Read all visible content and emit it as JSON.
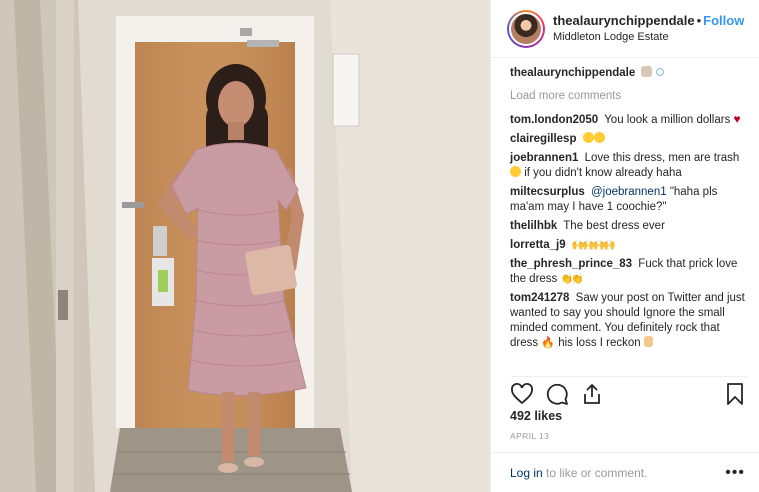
{
  "header": {
    "username": "thealaurynchippendale",
    "separator": "•",
    "follow_label": "Follow",
    "location": "Middleton Lodge Estate"
  },
  "caption": {
    "username": "thealaurynchippendale",
    "icons": [
      "people-emoji",
      "ring-emoji"
    ]
  },
  "load_more_label": "Load more comments",
  "comments": [
    {
      "user": "tom.london2050",
      "text": "You look a million dollars",
      "emoji": "red-heart"
    },
    {
      "user": "clairegillesp",
      "text": "",
      "emoji": "heart-eyes"
    },
    {
      "user": "joebrannen1",
      "text": "Love this dress, men are trash",
      "emoji": "slightly-smiling-face",
      "text2": "if you didn't know already haha"
    },
    {
      "user": "miltecsurplus",
      "mention": "@joebrannen1",
      "text": "\"haha pls ma'am may I have 1 coochie?\""
    },
    {
      "user": "thelilhbk",
      "text": "The best dress ever"
    },
    {
      "user": "lorretta_j9",
      "text": "",
      "emoji": "raised-hands"
    },
    {
      "user": "the_phresh_prince_83",
      "text": "Fuck that prick love the dress",
      "emoji": "clapping-hands"
    },
    {
      "user": "tom241278",
      "text": "Saw your post on Twitter and just wanted to say you should Ignore the small minded comment. You definitely rock that dress",
      "emoji": "fire",
      "text2": "his loss I reckon",
      "emoji2": "ok-hand"
    }
  ],
  "icons": {
    "like": "heart-icon",
    "comment": "comment-bubble-icon",
    "share": "share-icon",
    "save": "bookmark-icon"
  },
  "likes": "492 likes",
  "date": "APRIL 13",
  "footer": {
    "login_label": "Log in",
    "rest": " to like or comment.",
    "more_label": "•••"
  },
  "colors": {
    "link": "#3897f0",
    "muted": "#999999",
    "dress": "#c99ba2",
    "door": "#c98f55"
  }
}
